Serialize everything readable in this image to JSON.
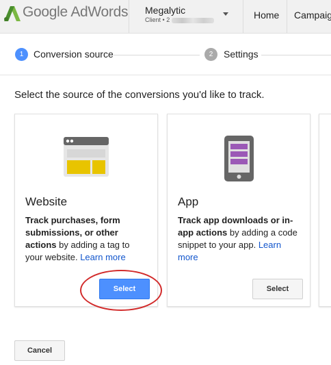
{
  "header": {
    "logo_google": "Google",
    "logo_product": "AdWords",
    "account_name": "Megalytic",
    "account_client_label": "Client •",
    "account_client_id": "2",
    "nav": [
      "Home",
      "Campaigns"
    ]
  },
  "stepper": {
    "steps": [
      {
        "number": "1",
        "label": "Conversion source",
        "active": true
      },
      {
        "number": "2",
        "label": "Settings",
        "active": false
      }
    ]
  },
  "main": {
    "prompt": "Select the source of the conversions you'd like to track.",
    "cards": [
      {
        "title": "Website",
        "desc_bold": "Track purchases, form submissions, or other actions",
        "desc_rest": " by adding a tag to your website. ",
        "link": "Learn more",
        "button": "Select",
        "icon": "browser-window-icon"
      },
      {
        "title": "App",
        "desc_bold": "Track app downloads or in-app actions",
        "desc_rest": " by adding a code snippet to your app. ",
        "link": "Learn more",
        "button": "Select",
        "icon": "smartphone-icon"
      }
    ],
    "cancel_label": "Cancel"
  },
  "colors": {
    "primary_button": "#4d90fe",
    "active_step": "#4d90fe",
    "link": "#1155cc",
    "annotation_ring": "#d22b2b"
  }
}
